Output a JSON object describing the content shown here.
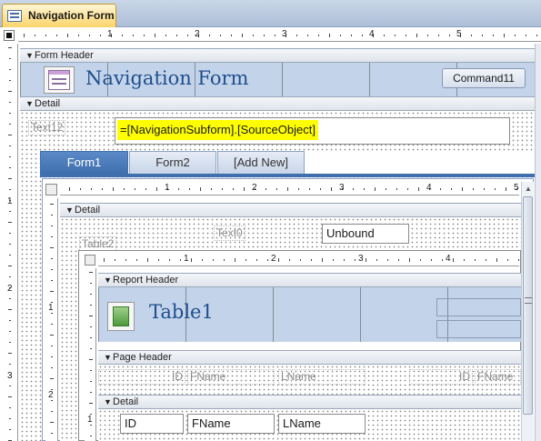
{
  "window": {
    "tab_title": "Navigation Form"
  },
  "form_header": {
    "section_label": "Form Header",
    "title": "Navigation Form",
    "command_button": "Command11"
  },
  "detail": {
    "section_label": "Detail",
    "text_label": "Text12",
    "expression": "=[NavigationSubform].[SourceObject]"
  },
  "nav_tabs": [
    {
      "label": "Form1",
      "active": true
    },
    {
      "label": "Form2",
      "active": false
    },
    {
      "label": "[Add New]",
      "active": false
    }
  ],
  "ruler_numbers": [
    "1",
    "2",
    "3",
    "4",
    "5"
  ],
  "vruler_numbers": [
    "1",
    "2",
    "3"
  ],
  "subform": {
    "ruler_numbers": [
      "1",
      "2",
      "3",
      "4",
      "5"
    ],
    "vruler_numbers": [
      "1",
      "2"
    ],
    "detail_label": "Detail",
    "text_label": "Text0",
    "unbound_value": "Unbound",
    "table_label": "Table2"
  },
  "subreport": {
    "ruler_numbers": [
      "1",
      "2",
      "3",
      "4"
    ],
    "vruler_numbers": [
      "1"
    ],
    "report_header_label": "Report Header",
    "title": "Table1",
    "page_header_label": "Page Header",
    "page_header_fields": [
      "ID",
      "FName",
      "LName",
      "ID",
      "FName"
    ],
    "detail_label": "Detail",
    "detail_fields": [
      "ID",
      "FName",
      "LName"
    ]
  },
  "colors": {
    "active_tab": "#3f6fae",
    "highlight": "#ffff00",
    "title_text": "#1f4e8c"
  }
}
